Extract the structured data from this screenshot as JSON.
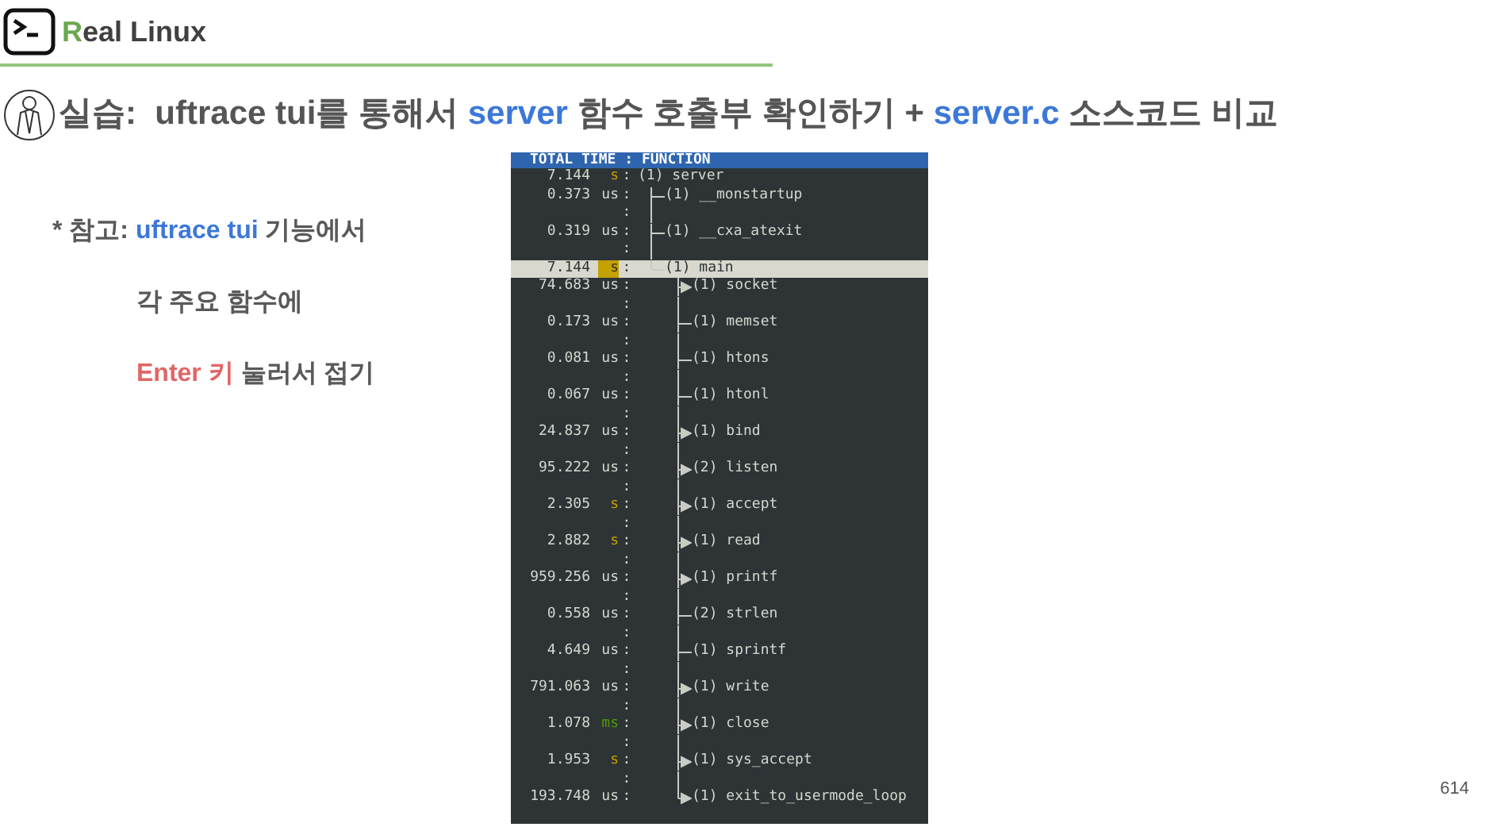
{
  "brand": [
    {
      "text": "R",
      "kind": "accent"
    },
    {
      "text": "eal Linux",
      "kind": "plain"
    }
  ],
  "title": [
    {
      "text": "실습:  uftrace tui를 통해서 ",
      "kind": "plain"
    },
    {
      "text": "server",
      "kind": "accent"
    },
    {
      "text": " 함수 호출부 확인하기 + ",
      "kind": "plain"
    },
    {
      "text": "server.c",
      "kind": "accent"
    },
    {
      "text": " 소스코드 비교",
      "kind": "plain"
    }
  ],
  "notes": [
    {
      "parts": [
        {
          "text": "* 참고: ",
          "kind": "plain"
        },
        {
          "text": "uftrace tui",
          "kind": "accent"
        },
        {
          "text": " 기능에서",
          "kind": "plain"
        }
      ],
      "indent": false
    },
    {
      "parts": [
        {
          "text": "각 주요 함수에",
          "kind": "plain"
        }
      ],
      "indent": true
    },
    {
      "parts": [
        {
          "text": "Enter 키",
          "kind": "warn"
        },
        {
          "text": " 눌러서 접기",
          "kind": "plain"
        }
      ],
      "indent": true
    }
  ],
  "terminal": {
    "header": "TOTAL TIME : FUNCTION",
    "rows": [
      {
        "time": "7.144",
        "unit": "s",
        "color": "#c4a000",
        "sep": ":",
        "label": "(1) server",
        "selected": false,
        "children": [
          {
            "time": "0.373",
            "unit": "us",
            "color": "#d3d7cf",
            "sep": ":",
            "label": "(1) __monstartup",
            "folded": false,
            "selected": false,
            "gap": ":"
          },
          {
            "time": "0.319",
            "unit": "us",
            "color": "#d3d7cf",
            "sep": ":",
            "label": "(1) __cxa_atexit",
            "folded": false,
            "selected": false,
            "gap": ":"
          },
          {
            "time": "7.144",
            "unit": "s",
            "color": "#c4a000",
            "sep": ":",
            "label": "(1) main",
            "folded": false,
            "selected": true,
            "children": [
              {
                "time": "74.683",
                "unit": "us",
                "color": "#d3d7cf",
                "sep": ":",
                "label": "(1) socket",
                "folded": true,
                "selected": false,
                "gap": ":"
              },
              {
                "time": "0.173",
                "unit": "us",
                "color": "#d3d7cf",
                "sep": ":",
                "label": "(1) memset",
                "folded": false,
                "selected": false,
                "gap": ":"
              },
              {
                "time": "0.081",
                "unit": "us",
                "color": "#d3d7cf",
                "sep": ":",
                "label": "(1) htons",
                "folded": false,
                "selected": false,
                "gap": ":"
              },
              {
                "time": "0.067",
                "unit": "us",
                "color": "#d3d7cf",
                "sep": ":",
                "label": "(1) htonl",
                "folded": false,
                "selected": false,
                "gap": ":"
              },
              {
                "time": "24.837",
                "unit": "us",
                "color": "#d3d7cf",
                "sep": ":",
                "label": "(1) bind",
                "folded": true,
                "selected": false,
                "gap": ":"
              },
              {
                "time": "95.222",
                "unit": "us",
                "color": "#d3d7cf",
                "sep": ":",
                "label": "(2) listen",
                "folded": true,
                "selected": false,
                "gap": ":"
              },
              {
                "time": "2.305",
                "unit": "s",
                "color": "#c4a000",
                "sep": ":",
                "label": "(1) accept",
                "folded": true,
                "selected": false,
                "gap": ":"
              },
              {
                "time": "2.882",
                "unit": "s",
                "color": "#c4a000",
                "sep": ":",
                "label": "(1) read",
                "folded": true,
                "selected": false,
                "gap": ":"
              },
              {
                "time": "959.256",
                "unit": "us",
                "color": "#d3d7cf",
                "sep": ":",
                "label": "(1) printf",
                "folded": true,
                "selected": false,
                "gap": ":"
              },
              {
                "time": "0.558",
                "unit": "us",
                "color": "#d3d7cf",
                "sep": ":",
                "label": "(2) strlen",
                "folded": false,
                "selected": false,
                "gap": ":"
              },
              {
                "time": "4.649",
                "unit": "us",
                "color": "#d3d7cf",
                "sep": ":",
                "label": "(1) sprintf",
                "folded": false,
                "selected": false,
                "gap": ":"
              },
              {
                "time": "791.063",
                "unit": "us",
                "color": "#d3d7cf",
                "sep": ":",
                "label": "(1) write",
                "folded": true,
                "selected": false,
                "gap": ":"
              },
              {
                "time": "1.078",
                "unit": "ms",
                "color": "#4e9a06",
                "sep": ":",
                "label": "(1) close",
                "folded": true,
                "selected": false,
                "gap": ":"
              },
              {
                "time": "1.953",
                "unit": "s",
                "color": "#c4a000",
                "sep": ":",
                "label": "(1) sys_accept",
                "folded": true,
                "selected": false,
                "gap": ":"
              },
              {
                "time": "193.748",
                "unit": "us",
                "color": "#d3d7cf",
                "sep": ":",
                "label": "(1) exit_to_usermode_loop",
                "folded": true,
                "selected": false
              }
            ]
          }
        ]
      }
    ]
  },
  "page_number": "614"
}
